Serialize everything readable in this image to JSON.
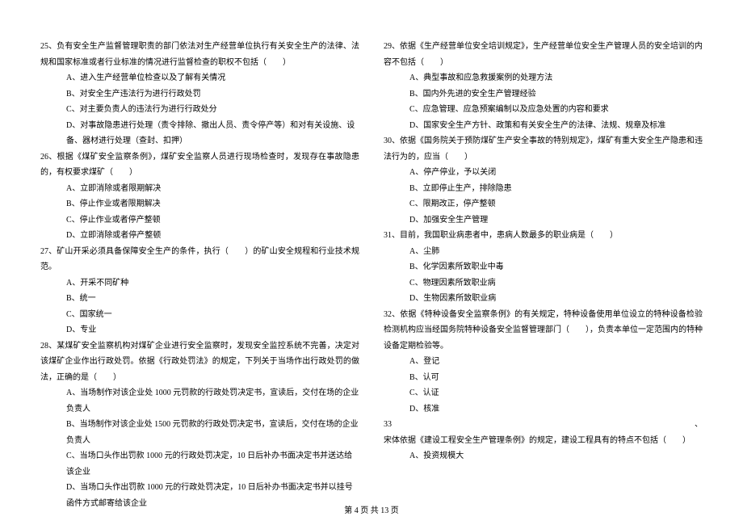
{
  "left_column": {
    "questions": [
      {
        "num": "25、",
        "text": "负有安全生产监督管理职责的部门依法对生产经营单位执行有关安全生产的法律、法规和国家标准或者行业标准的情况进行监督检查的职权不包括（　　）",
        "options": [
          "A、进入生产经营单位检查以及了解有关情况",
          "B、对安全生产违法行为进行行政处罚",
          "C、对主要负责人的违法行为进行行政处分",
          "D、对事故隐患进行处理（责令排除、撤出人员、责令停产等）和对有关设施、设备、器材进行处理（查封、扣押）"
        ]
      },
      {
        "num": "26、",
        "text": "根据《煤矿安全监察条例》，煤矿安全监察人员进行现场检查时，发现存在事故隐患的，有权要求煤矿（　　）",
        "options": [
          "A、立即消除或者限期解决",
          "B、停止作业或者限期解决",
          "C、停止作业或者停产整顿",
          "D、立即消除或者停产整顿"
        ]
      },
      {
        "num": "27、",
        "text": "矿山开采必须具备保障安全生产的条件，执行（　　）的矿山安全规程和行业技术规范。",
        "options": [
          "A、开采不同矿种",
          "B、统一",
          "C、国家统一",
          "D、专业"
        ]
      },
      {
        "num": "28、",
        "text": "某煤矿安全监察机构对煤矿企业进行安全监察时，发现安全监控系统不完善，决定对该煤矿企业作出行政处罚。依据《行政处罚法》的规定，下列关于当场作出行政处罚的做法，正确的是（　　）",
        "options": [
          "A、当场制作对该企业处 1000 元罚款的行政处罚决定书，宣读后，交付在场的企业负责人",
          "B、当场制作对该企业处 1500 元罚款的行政处罚决定书，宣读后，交付在场的企业负责人",
          "C、当场口头作出罚款 1000 元的行政处罚决定，10 日后补办书面决定书并送达给该企业",
          "D、当场口头作出罚款 1000 元的行政处罚决定，10 日后补办书面决定书并以挂号函件方式邮寄给该企业"
        ]
      }
    ]
  },
  "right_column": {
    "questions": [
      {
        "num": "29、",
        "text": "依据《生产经营单位安全培训规定》，生产经营单位安全生产管理人员的安全培训的内容不包括（　　）",
        "options": [
          "A、典型事故和应急救援案例的处理方法",
          "B、国内外先进的安全生产管理经验",
          "C、应急管理、应急预案编制以及应急处置的内容和要求",
          "D、国家安全生产方针、政策和有关安全生产的法律、法规、规章及标准"
        ]
      },
      {
        "num": "30、",
        "text": "依据《国务院关于预防煤矿生产安全事故的特别规定》，煤矿有重大安全生产隐患和违法行为的，应当（　　）",
        "options": [
          "A、停产停业，予以关闭",
          "B、立即停止生产，排除隐患",
          "C、限期改正，停产整顿",
          "D、加强安全生产管理"
        ]
      },
      {
        "num": "31、",
        "text": "目前，我国职业病患者中，患病人数最多的职业病是（　　）",
        "options": [
          "A、尘肺",
          "B、化学因素所致职业中毒",
          "C、物理因素所致职业病",
          "D、生物因素所致职业病"
        ]
      },
      {
        "num": "32、",
        "text": "依据《特种设备安全监察条例》的有关规定，特种设备使用单位设立的特种设备检验检测机构应当经国务院特种设备安全监督管理部门（　　），负责本单位一定范围内的特种设备定期检验等。",
        "options": [
          "A、登记",
          "B、认可",
          "C、认证",
          "D、核准"
        ]
      },
      {
        "num": "33、",
        "text": "宋体依据《建设工程安全生产管理条例》的规定，建设工程具有的特点不包括（　　）",
        "options": [
          "A、投资规模大"
        ]
      }
    ]
  },
  "footer": "第 4 页 共 13 页"
}
